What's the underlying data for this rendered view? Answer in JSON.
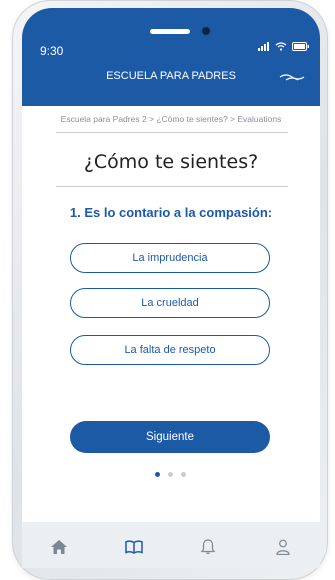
{
  "status_bar": {
    "time": "9:30"
  },
  "header": {
    "title": "ESCUELA PARA PADRES"
  },
  "breadcrumb": "Escuela para Padres 2 > ¿Cómo te sientes? > Evaluations",
  "page_title": "¿Cómo te sientes?",
  "question": "1. Es lo contario a la compasión:",
  "options": [
    {
      "label": "La imprudencia"
    },
    {
      "label": "La crueldad"
    },
    {
      "label": "La falta de respeto"
    }
  ],
  "next_button": "Siguiente",
  "pagination": {
    "total": 3,
    "active": 1
  },
  "nav": [
    {
      "icon": "home-icon"
    },
    {
      "icon": "book-icon"
    },
    {
      "icon": "bell-icon"
    },
    {
      "icon": "user-icon"
    }
  ],
  "colors": {
    "primary": "#1d5aa6",
    "nav_bg": "#eceff2",
    "nav_icon": "#7c8794"
  }
}
